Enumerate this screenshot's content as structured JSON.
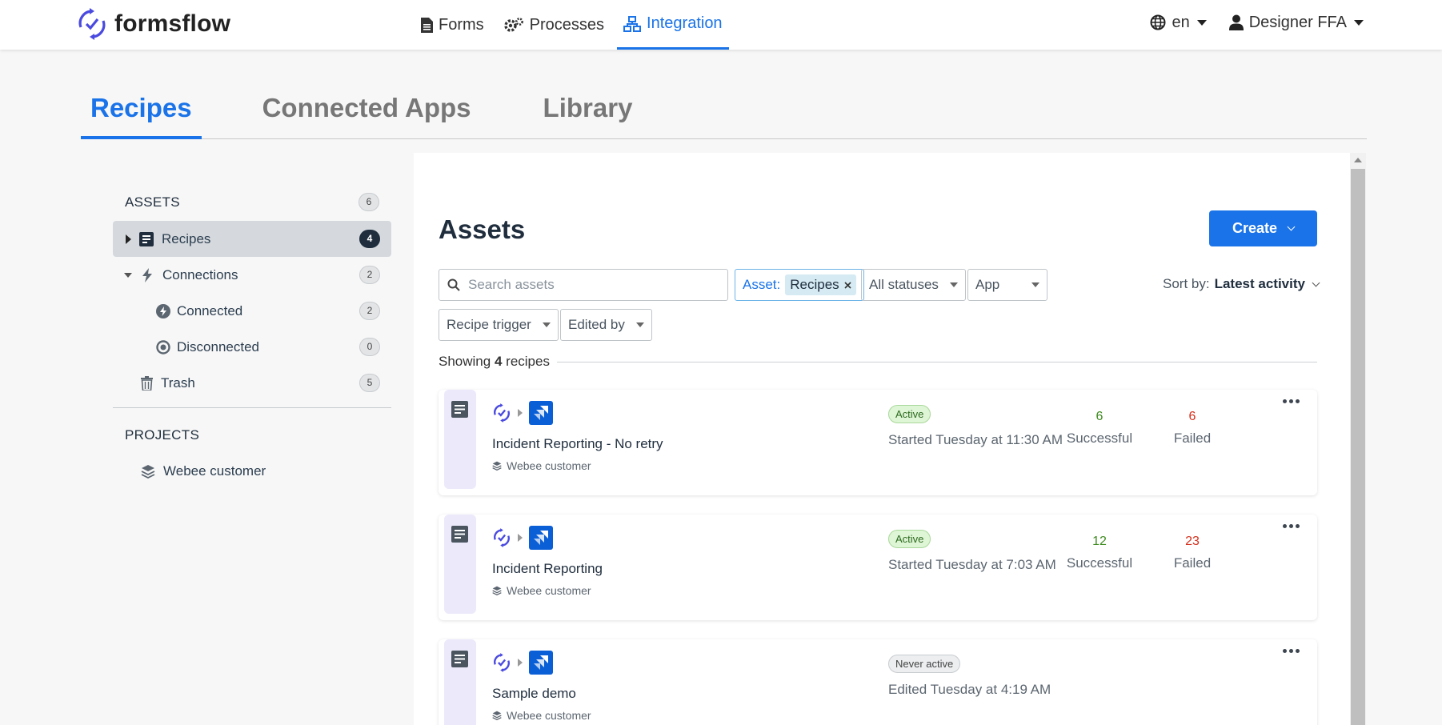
{
  "brand": {
    "name": "formsflow"
  },
  "nav": {
    "items": [
      {
        "label": "Forms",
        "icon": "document-icon"
      },
      {
        "label": "Processes",
        "icon": "gears-icon"
      },
      {
        "label": "Integration",
        "icon": "sitemap-icon",
        "active": true
      }
    ],
    "language": "en",
    "user": "Designer FFA"
  },
  "tabs": [
    {
      "label": "Recipes",
      "active": true
    },
    {
      "label": "Connected Apps"
    },
    {
      "label": "Library"
    }
  ],
  "sidebar": {
    "assets_title": "ASSETS",
    "assets_count": "6",
    "items": [
      {
        "label": "Recipes",
        "count": "4"
      },
      {
        "label": "Connections",
        "count": "2"
      },
      {
        "label": "Connected",
        "count": "2"
      },
      {
        "label": "Disconnected",
        "count": "0"
      },
      {
        "label": "Trash",
        "count": "5"
      }
    ],
    "projects_title": "PROJECTS",
    "projects": [
      {
        "label": "Webee customer"
      }
    ]
  },
  "main": {
    "title": "Assets",
    "create_label": "Create",
    "search_placeholder": "Search assets",
    "filters": {
      "asset_label": "Asset:",
      "asset_value": "Recipes",
      "statuses": "All statuses",
      "app": "App",
      "recipe_trigger": "Recipe trigger",
      "edited_by": "Edited by"
    },
    "sort_label": "Sort by:",
    "sort_value": "Latest activity",
    "showing_prefix": "Showing",
    "showing_count": "4",
    "showing_suffix": "recipes"
  },
  "recipes": [
    {
      "name": "Incident Reporting - No retry",
      "project": "Webee customer",
      "status": "Active",
      "time": "Started Tuesday at 11:30 AM",
      "successful": "6",
      "failed": "6",
      "successful_label": "Successful",
      "failed_label": "Failed"
    },
    {
      "name": "Incident Reporting",
      "project": "Webee customer",
      "status": "Active",
      "time": "Started Tuesday at 7:03 AM",
      "successful": "12",
      "failed": "23",
      "successful_label": "Successful",
      "failed_label": "Failed"
    },
    {
      "name": "Sample demo",
      "project": "Webee customer",
      "status": "Never active",
      "time": "Edited Tuesday at 4:19 AM"
    }
  ],
  "colors": {
    "accent": "#1a73e8",
    "success": "#3e8b1f",
    "failure": "#d6301c"
  }
}
